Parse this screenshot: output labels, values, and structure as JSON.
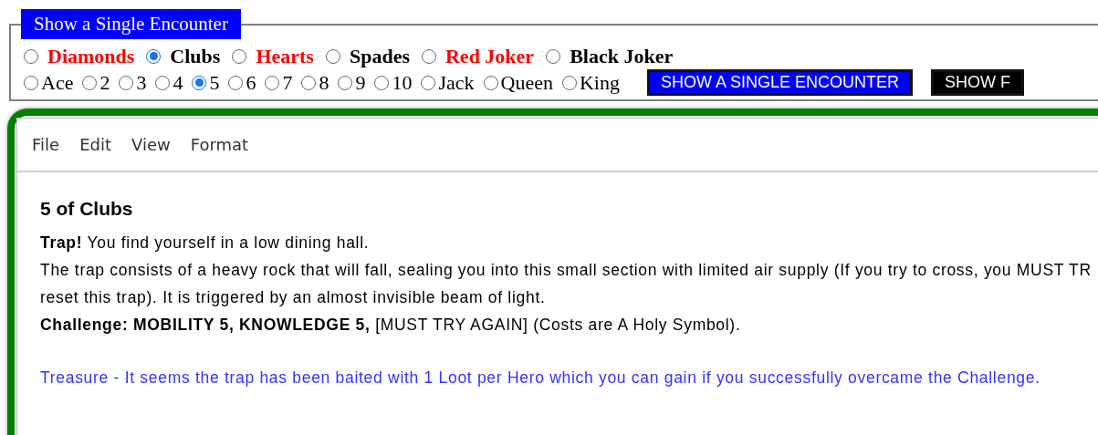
{
  "form": {
    "legend": "Show a Single Encounter",
    "suits": [
      {
        "label": "Diamonds",
        "selected": false,
        "color": "#ff0000"
      },
      {
        "label": "Clubs",
        "selected": true,
        "color": "#000000"
      },
      {
        "label": "Hearts",
        "selected": false,
        "color": "#ff0000"
      },
      {
        "label": "Spades",
        "selected": false,
        "color": "#000000"
      },
      {
        "label": "Red Joker",
        "selected": false,
        "color": "#ff0000"
      },
      {
        "label": "Black Joker",
        "selected": false,
        "color": "#000000"
      }
    ],
    "ranks": [
      {
        "label": "Ace",
        "selected": false
      },
      {
        "label": "2",
        "selected": false
      },
      {
        "label": "3",
        "selected": false
      },
      {
        "label": "4",
        "selected": false
      },
      {
        "label": "5",
        "selected": true
      },
      {
        "label": "6",
        "selected": false
      },
      {
        "label": "7",
        "selected": false
      },
      {
        "label": "8",
        "selected": false
      },
      {
        "label": "9",
        "selected": false
      },
      {
        "label": "10",
        "selected": false
      },
      {
        "label": "Jack",
        "selected": false
      },
      {
        "label": "Queen",
        "selected": false
      },
      {
        "label": "King",
        "selected": false
      }
    ],
    "buttons": [
      {
        "label": "SHOW A SINGLE ENCOUNTER",
        "color": "#0000ff"
      },
      {
        "label": "SHOW F",
        "color": "#000000"
      }
    ]
  },
  "editor": {
    "menu": [
      "File",
      "Edit",
      "View",
      "Format"
    ],
    "title": "5 of Clubs",
    "lines": [
      {
        "text": "**Trap!** You find yourself in a low dining hall.",
        "color": "#000000"
      },
      {
        "text": "The trap consists of a heavy rock that will fall, sealing you into this small section with limited air supply (If you try to cross, you MUST TR",
        "color": "#000000"
      },
      {
        "text": "reset this trap). It is triggered by an almost invisible beam of light.",
        "color": "#000000"
      },
      {
        "text": "**Challenge: MOBILITY 5, KNOWLEDGE 5,** [MUST TRY AGAIN] (Costs are A Holy Symbol).",
        "color": "#000000"
      },
      {
        "text": "Treasure - It seems the trap has been baited with 1 Loot per Hero which you can gain if you successfully overcame the Challenge.",
        "color": "#3333ff",
        "gap": true
      }
    ]
  }
}
